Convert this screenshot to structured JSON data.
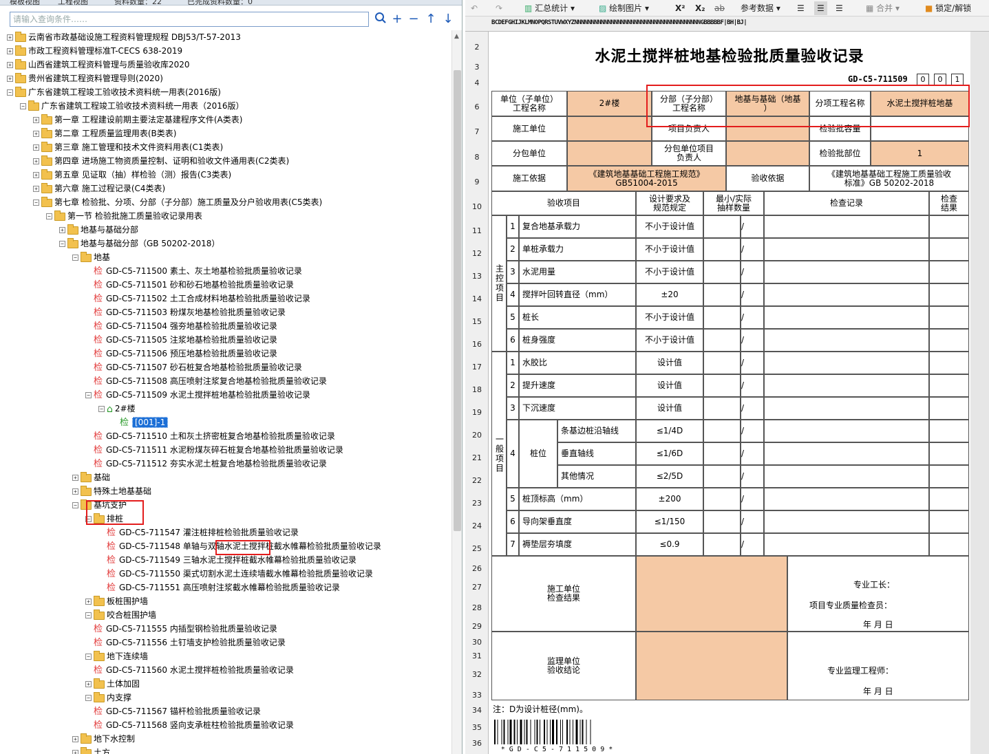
{
  "left": {
    "tabs": [
      "模板视图",
      "工程视图",
      "资料数量：22",
      "已完成资料数量：0"
    ],
    "search_placeholder": "请输入查询条件……",
    "tree": [
      {
        "d": 0,
        "exp": "+",
        "icon": "folder",
        "label": "云南省市政基础设施工程资料管理规程 DBJ53/T-57-2013"
      },
      {
        "d": 0,
        "exp": "+",
        "icon": "folder",
        "label": "市政工程资料管理标准T-CECS 638-2019"
      },
      {
        "d": 0,
        "exp": "+",
        "icon": "folder",
        "label": "山西省建筑工程资料管理与质量验收库2020"
      },
      {
        "d": 0,
        "exp": "+",
        "icon": "folder",
        "label": "贵州省建筑工程资料管理导则(2020)"
      },
      {
        "d": 0,
        "exp": "-",
        "icon": "folder",
        "label": "广东省建筑工程竣工验收技术资料统一用表(2016版)"
      },
      {
        "d": 1,
        "exp": "-",
        "icon": "folder",
        "label": "广东省建筑工程竣工验收技术资料统一用表（2016版）"
      },
      {
        "d": 2,
        "exp": "+",
        "icon": "folder",
        "label": "第一章 工程建设前期主要法定基建程序文件(A类表)"
      },
      {
        "d": 2,
        "exp": "+",
        "icon": "folder",
        "label": "第二章 工程质量监理用表(B类表)"
      },
      {
        "d": 2,
        "exp": "+",
        "icon": "folder",
        "label": "第三章 施工管理和技术文件资料用表(C1类表)"
      },
      {
        "d": 2,
        "exp": "+",
        "icon": "folder",
        "label": "第四章 进场施工物资质量控制、证明和验收文件通用表(C2类表)"
      },
      {
        "d": 2,
        "exp": "+",
        "icon": "folder",
        "label": "第五章  见证取（抽）样检验（测）报告(C3类表)"
      },
      {
        "d": 2,
        "exp": "+",
        "icon": "folder",
        "label": "第六章 施工过程记录(C4类表)"
      },
      {
        "d": 2,
        "exp": "-",
        "icon": "folder",
        "label": "第七章 检验批、分项、分部（子分部）施工质量及分户验收用表(C5类表)"
      },
      {
        "d": 3,
        "exp": "-",
        "icon": "folder",
        "label": "第一节 检验批施工质量验收记录用表"
      },
      {
        "d": 4,
        "exp": "+",
        "icon": "folder",
        "label": "地基与基础分部"
      },
      {
        "d": 4,
        "exp": "-",
        "icon": "folder",
        "label": "地基与基础分部（GB 50202-2018）"
      },
      {
        "d": 5,
        "exp": "-",
        "icon": "folder",
        "label": "地基"
      },
      {
        "d": 6,
        "exp": "",
        "icon": "check",
        "label": "GD-C5-711500 素土、灰土地基检验批质量验收记录"
      },
      {
        "d": 6,
        "exp": "",
        "icon": "check",
        "label": "GD-C5-711501 砂和砂石地基检验批质量验收记录"
      },
      {
        "d": 6,
        "exp": "",
        "icon": "check",
        "label": "GD-C5-711502 土工合成材料地基检验批质量验收记录"
      },
      {
        "d": 6,
        "exp": "",
        "icon": "check",
        "label": "GD-C5-711503 粉煤灰地基检验批质量验收记录"
      },
      {
        "d": 6,
        "exp": "",
        "icon": "check",
        "label": "GD-C5-711504 强夯地基检验批质量验收记录"
      },
      {
        "d": 6,
        "exp": "",
        "icon": "check",
        "label": "GD-C5-711505 注浆地基检验批质量验收记录"
      },
      {
        "d": 6,
        "exp": "",
        "icon": "check",
        "label": "GD-C5-711506 预压地基检验批质量验收记录"
      },
      {
        "d": 6,
        "exp": "",
        "icon": "check",
        "label": "GD-C5-711507 砂石桩复合地基检验批质量验收记录"
      },
      {
        "d": 6,
        "exp": "",
        "icon": "check",
        "label": "GD-C5-711508 高压喷射注浆复合地基检验批质量验收记录"
      },
      {
        "d": 6,
        "exp": "-",
        "icon": "check",
        "label": "GD-C5-711509 水泥土搅拌桩地基检验批质量验收记录"
      },
      {
        "d": 7,
        "exp": "-",
        "icon": "home",
        "label": "2#楼"
      },
      {
        "d": 8,
        "exp": "",
        "icon": "checkg",
        "label": "[001]-1",
        "selected": true
      },
      {
        "d": 6,
        "exp": "",
        "icon": "check",
        "label": "GD-C5-711510 土和灰土挤密桩复合地基检验批质量验收记录"
      },
      {
        "d": 6,
        "exp": "",
        "icon": "check",
        "label": "GD-C5-711511 水泥粉煤灰碎石桩复合地基检验批质量验收记录"
      },
      {
        "d": 6,
        "exp": "",
        "icon": "check",
        "label": "GD-C5-711512 夯实水泥土桩复合地基检验批质量验收记录"
      },
      {
        "d": 5,
        "exp": "+",
        "icon": "folder",
        "label": "基础"
      },
      {
        "d": 5,
        "exp": "+",
        "icon": "folder",
        "label": "特殊土地基基础"
      },
      {
        "d": 5,
        "exp": "-",
        "icon": "folder",
        "label": "基坑支护"
      },
      {
        "d": 6,
        "exp": "-",
        "icon": "folder",
        "label": "排桩"
      },
      {
        "d": 7,
        "exp": "",
        "icon": "check",
        "label": "GD-C5-711547 灌注桩排桩检验批质量验收记录"
      },
      {
        "d": 7,
        "exp": "",
        "icon": "check",
        "label": "GD-C5-711548 单轴与双轴水泥土搅拌桩截水帷幕检验批质量验收记录"
      },
      {
        "d": 7,
        "exp": "",
        "icon": "check",
        "label": "GD-C5-711549 三轴水泥土搅拌桩截水帷幕检验批质量验收记录"
      },
      {
        "d": 7,
        "exp": "",
        "icon": "check",
        "label": "GD-C5-711550 渠式切割水泥土连续墙截水帷幕检验批质量验收记录"
      },
      {
        "d": 7,
        "exp": "",
        "icon": "check",
        "label": "GD-C5-711551 高压喷射注浆截水帷幕检验批质量验收记录"
      },
      {
        "d": 6,
        "exp": "+",
        "icon": "folder",
        "label": "板桩围护墙"
      },
      {
        "d": 6,
        "exp": "-",
        "icon": "folder",
        "label": "咬合桩围护墙"
      },
      {
        "d": 6,
        "exp": "",
        "icon": "check",
        "label": "GD-C5-711555 内插型钢检验批质量验收记录"
      },
      {
        "d": 6,
        "exp": "",
        "icon": "check",
        "label": "GD-C5-711556 土钉墙支护检验批质量验收记录"
      },
      {
        "d": 6,
        "exp": "-",
        "icon": "folder",
        "label": "地下连续墙"
      },
      {
        "d": 6,
        "exp": "",
        "icon": "check",
        "label": "GD-C5-711560 水泥土搅拌桩检验批质量验收记录"
      },
      {
        "d": 6,
        "exp": "+",
        "icon": "folder",
        "label": "土体加固"
      },
      {
        "d": 6,
        "exp": "-",
        "icon": "folder",
        "label": "内支撑"
      },
      {
        "d": 6,
        "exp": "",
        "icon": "check",
        "label": "GD-C5-711567 锚杆检验批质量验收记录"
      },
      {
        "d": 6,
        "exp": "",
        "icon": "check",
        "label": "GD-C5-711568 竖向支承桩柱检验批质量验收记录"
      },
      {
        "d": 5,
        "exp": "+",
        "icon": "folder",
        "label": "地下水控制"
      },
      {
        "d": 5,
        "exp": "+",
        "icon": "folder",
        "label": "土方"
      }
    ]
  },
  "toolbar": {
    "summary": "汇总统计",
    "draw": "绘制图片",
    "sup": "X²",
    "sub": "X₂",
    "strike": "ab",
    "ref": "参考数据",
    "merge": "合并",
    "lock": "锁定/解锁"
  },
  "columns_header": "BCDEFGHIJKLMNOPQRSTUVWXYZNNNNNNNNNNNNNNNNNNNNNNNNNNNNNNNNNNNNNNGBBBBBF|BH|BJ|",
  "row_numbers": [
    "2",
    "3",
    "4",
    "6",
    "7",
    "8",
    "9",
    "10",
    "11",
    "12",
    "13",
    "14",
    "15",
    "16",
    "17",
    "18",
    "19",
    "20",
    "21",
    "22",
    "23",
    "24",
    "25",
    "26",
    "27",
    "28",
    "29",
    "30",
    "31",
    "32",
    "33",
    "34",
    "35",
    "36"
  ],
  "doc": {
    "title": "水泥土搅拌桩地基检验批质量验收记录",
    "code": "GD-C5-711509",
    "code_boxes": [
      "0",
      "0",
      "1"
    ],
    "unit_label": "单位（子单位）\n工程名称",
    "unit_value": "2#楼",
    "sub_label": "分部（子分部）\n工程名称",
    "sub_value": "地基与基础（地基\n）",
    "item_label": "分项工程名称",
    "item_value": "水泥土搅拌桩地基",
    "construct_unit": "施工单位",
    "project_leader": "项目负责人",
    "batch_capacity": "检验批容量",
    "subcontract_unit": "分包单位",
    "subcontract_leader": "分包单位项目\n负责人",
    "batch_location": "检验批部位",
    "batch_location_value": "1",
    "basis_label": "施工依据",
    "basis_value": "《建筑地基基础工程施工规范》\nGB51004-2015",
    "accept_label": "验收依据",
    "accept_value": "《建筑地基基础工程施工质量验收\n标准》GB 50202-2018",
    "h_item": "验收项目",
    "h_design": "设计要求及\n规范规定",
    "h_sample": "最小/实际\n抽样数量",
    "h_record": "检查记录",
    "h_result": "检查\n结果",
    "main_label": "主控项目",
    "general_label": "一般项目",
    "main_items": [
      {
        "no": "1",
        "name": "复合地基承载力",
        "req": "不小于设计值"
      },
      {
        "no": "2",
        "name": "单桩承载力",
        "req": "不小于设计值"
      },
      {
        "no": "3",
        "name": "水泥用量",
        "req": "不小于设计值"
      },
      {
        "no": "4",
        "name": "搅拌叶回转直径（mm）",
        "req": "±20"
      },
      {
        "no": "5",
        "name": "桩长",
        "req": "不小于设计值"
      },
      {
        "no": "6",
        "name": "桩身强度",
        "req": "不小于设计值"
      }
    ],
    "general_items": [
      {
        "no": "1",
        "name": "水胶比",
        "req": "设计值"
      },
      {
        "no": "2",
        "name": "提升速度",
        "req": "设计值"
      },
      {
        "no": "3",
        "name": "下沉速度",
        "req": "设计值"
      },
      {
        "no": "4",
        "name": "桩位",
        "sub": [
          {
            "name": "条基边桩沿轴线",
            "req": "≤1/4D"
          },
          {
            "name": "垂直轴线",
            "req": "≤1/6D"
          },
          {
            "name": "其他情况",
            "req": "≤2/5D"
          }
        ]
      },
      {
        "no": "5",
        "name": "桩顶标高（mm）",
        "req": "±200"
      },
      {
        "no": "6",
        "name": "导向架垂直度",
        "req": "≤1/150"
      },
      {
        "no": "7",
        "name": "褥垫层夯填度",
        "req": "≤0.9"
      }
    ],
    "slash": "/",
    "construct_result": "施工单位\n检查结果",
    "foreman": "专业工长：",
    "qc_inspector": "项目专业质量检查员：",
    "date": "年   月   日",
    "supervisor_result": "监理单位\n验收结论",
    "supervisor_engineer": "专业监理工程师：",
    "note": "注：D为设计桩径(mm)。",
    "barcode_text": "* G D - C 5 - 7 1 1 5 0 9 *"
  },
  "colors": {
    "peach": "#f5c9a5",
    "highlight_red": "#e31c1c",
    "selection": "#1c6fd6"
  }
}
